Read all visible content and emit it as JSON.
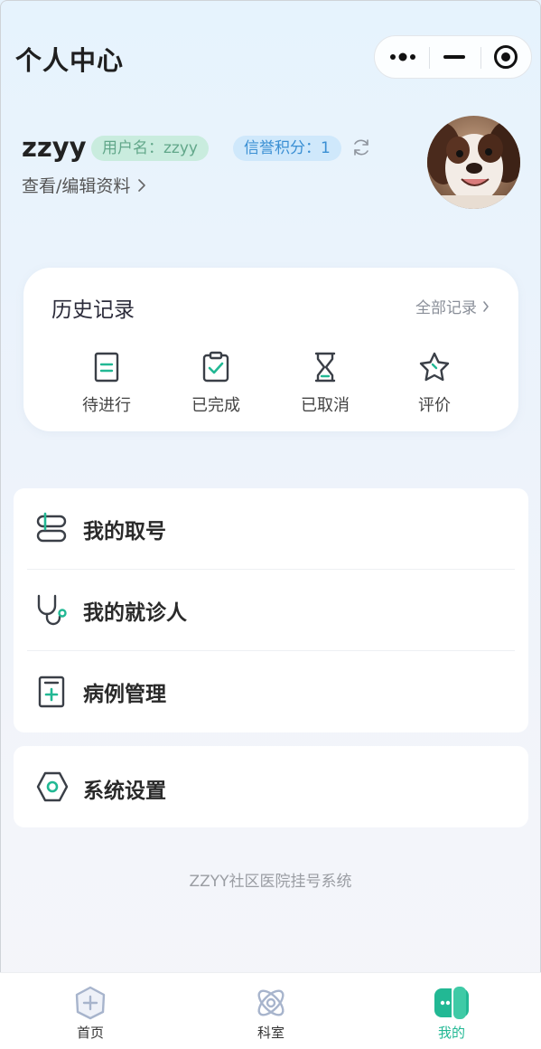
{
  "header": {
    "title": "个人中心"
  },
  "capsule": {
    "more_icon": "more-dots-icon",
    "minimize_icon": "minimize-icon",
    "close_icon": "target-icon"
  },
  "profile": {
    "username": "zzyy",
    "username_tag": "用户名：zzyy",
    "credit_tag": "信誉积分：1",
    "view_edit_label": "查看/编辑资料"
  },
  "history": {
    "title": "历史记录",
    "all_label": "全部记录",
    "items": [
      {
        "label": "待进行",
        "icon": "document-icon"
      },
      {
        "label": "已完成",
        "icon": "clipboard-check-icon"
      },
      {
        "label": "已取消",
        "icon": "hourglass-icon"
      },
      {
        "label": "评价",
        "icon": "star-icon"
      }
    ]
  },
  "menu": {
    "items": [
      {
        "label": "我的取号",
        "icon": "ticket-stack-icon"
      },
      {
        "label": "我的就诊人",
        "icon": "stethoscope-icon"
      },
      {
        "label": "病例管理",
        "icon": "medical-record-icon"
      }
    ]
  },
  "settings": {
    "label": "系统设置",
    "icon": "hexagon-settings-icon"
  },
  "footer": {
    "text": "ZZYY社区医院挂号系统"
  },
  "tabbar": {
    "items": [
      {
        "label": "首页",
        "icon": "home-hexagon-icon",
        "active": false
      },
      {
        "label": "科室",
        "icon": "atom-icon",
        "active": false
      },
      {
        "label": "我的",
        "icon": "profile-card-icon",
        "active": true
      }
    ]
  },
  "colors": {
    "accent": "#22b894",
    "icon_dark": "#3a3f47",
    "tab_inactive": "#a7b4cc"
  }
}
